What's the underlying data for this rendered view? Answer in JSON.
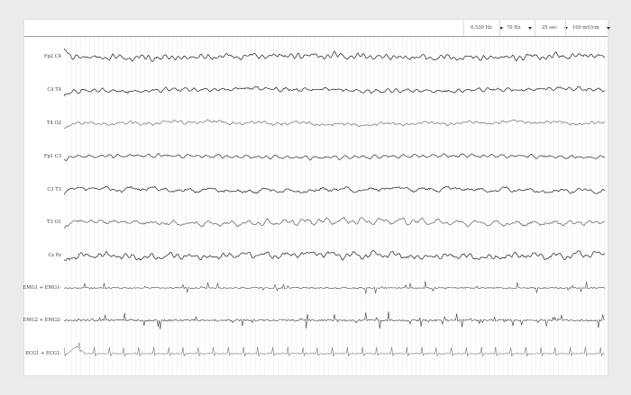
{
  "toolbar": {
    "filters": [
      {
        "label": "0,530 Hz"
      },
      {
        "label": "70 Hz"
      },
      {
        "label": "25 sec"
      },
      {
        "label": "100 mV/cm"
      }
    ]
  },
  "channels": [
    {
      "label": "Fp2 C4",
      "type": "eeg",
      "color": "#2b2b2b",
      "amplitude": 1.0
    },
    {
      "label": "C4 T4",
      "type": "eeg",
      "color": "#2b2b2b",
      "amplitude": 1.0
    },
    {
      "label": "T4 O2",
      "type": "eeg",
      "color": "#7a7a7a",
      "amplitude": 1.0
    },
    {
      "label": "Fp1 C3",
      "type": "eeg",
      "color": "#3a3a3a",
      "amplitude": 0.8
    },
    {
      "label": "C3 T3",
      "type": "eeg",
      "color": "#2b2b2b",
      "amplitude": 1.0
    },
    {
      "label": "T3 O1",
      "type": "eeg",
      "color": "#666666",
      "amplitude": 1.2
    },
    {
      "label": "Cz Pz",
      "type": "eeg",
      "color": "#2b2b2b",
      "amplitude": 1.1
    },
    {
      "label": "EMG1 + EMG1-",
      "type": "emg",
      "color": "#4a4a4a",
      "amplitude": 1.0
    },
    {
      "label": "EMG2 + EMG2-",
      "type": "emg",
      "color": "#3a3a3a",
      "amplitude": 1.3
    },
    {
      "label": "ECG1 + ECG1-",
      "type": "ecg",
      "color": "#7a7a7a",
      "amplitude": 1.0
    }
  ],
  "colors": {
    "background": "#ebebeb",
    "panel": "#ffffff",
    "grid": "#e3e3e3",
    "toolbar_border": "#9a9a9a"
  }
}
